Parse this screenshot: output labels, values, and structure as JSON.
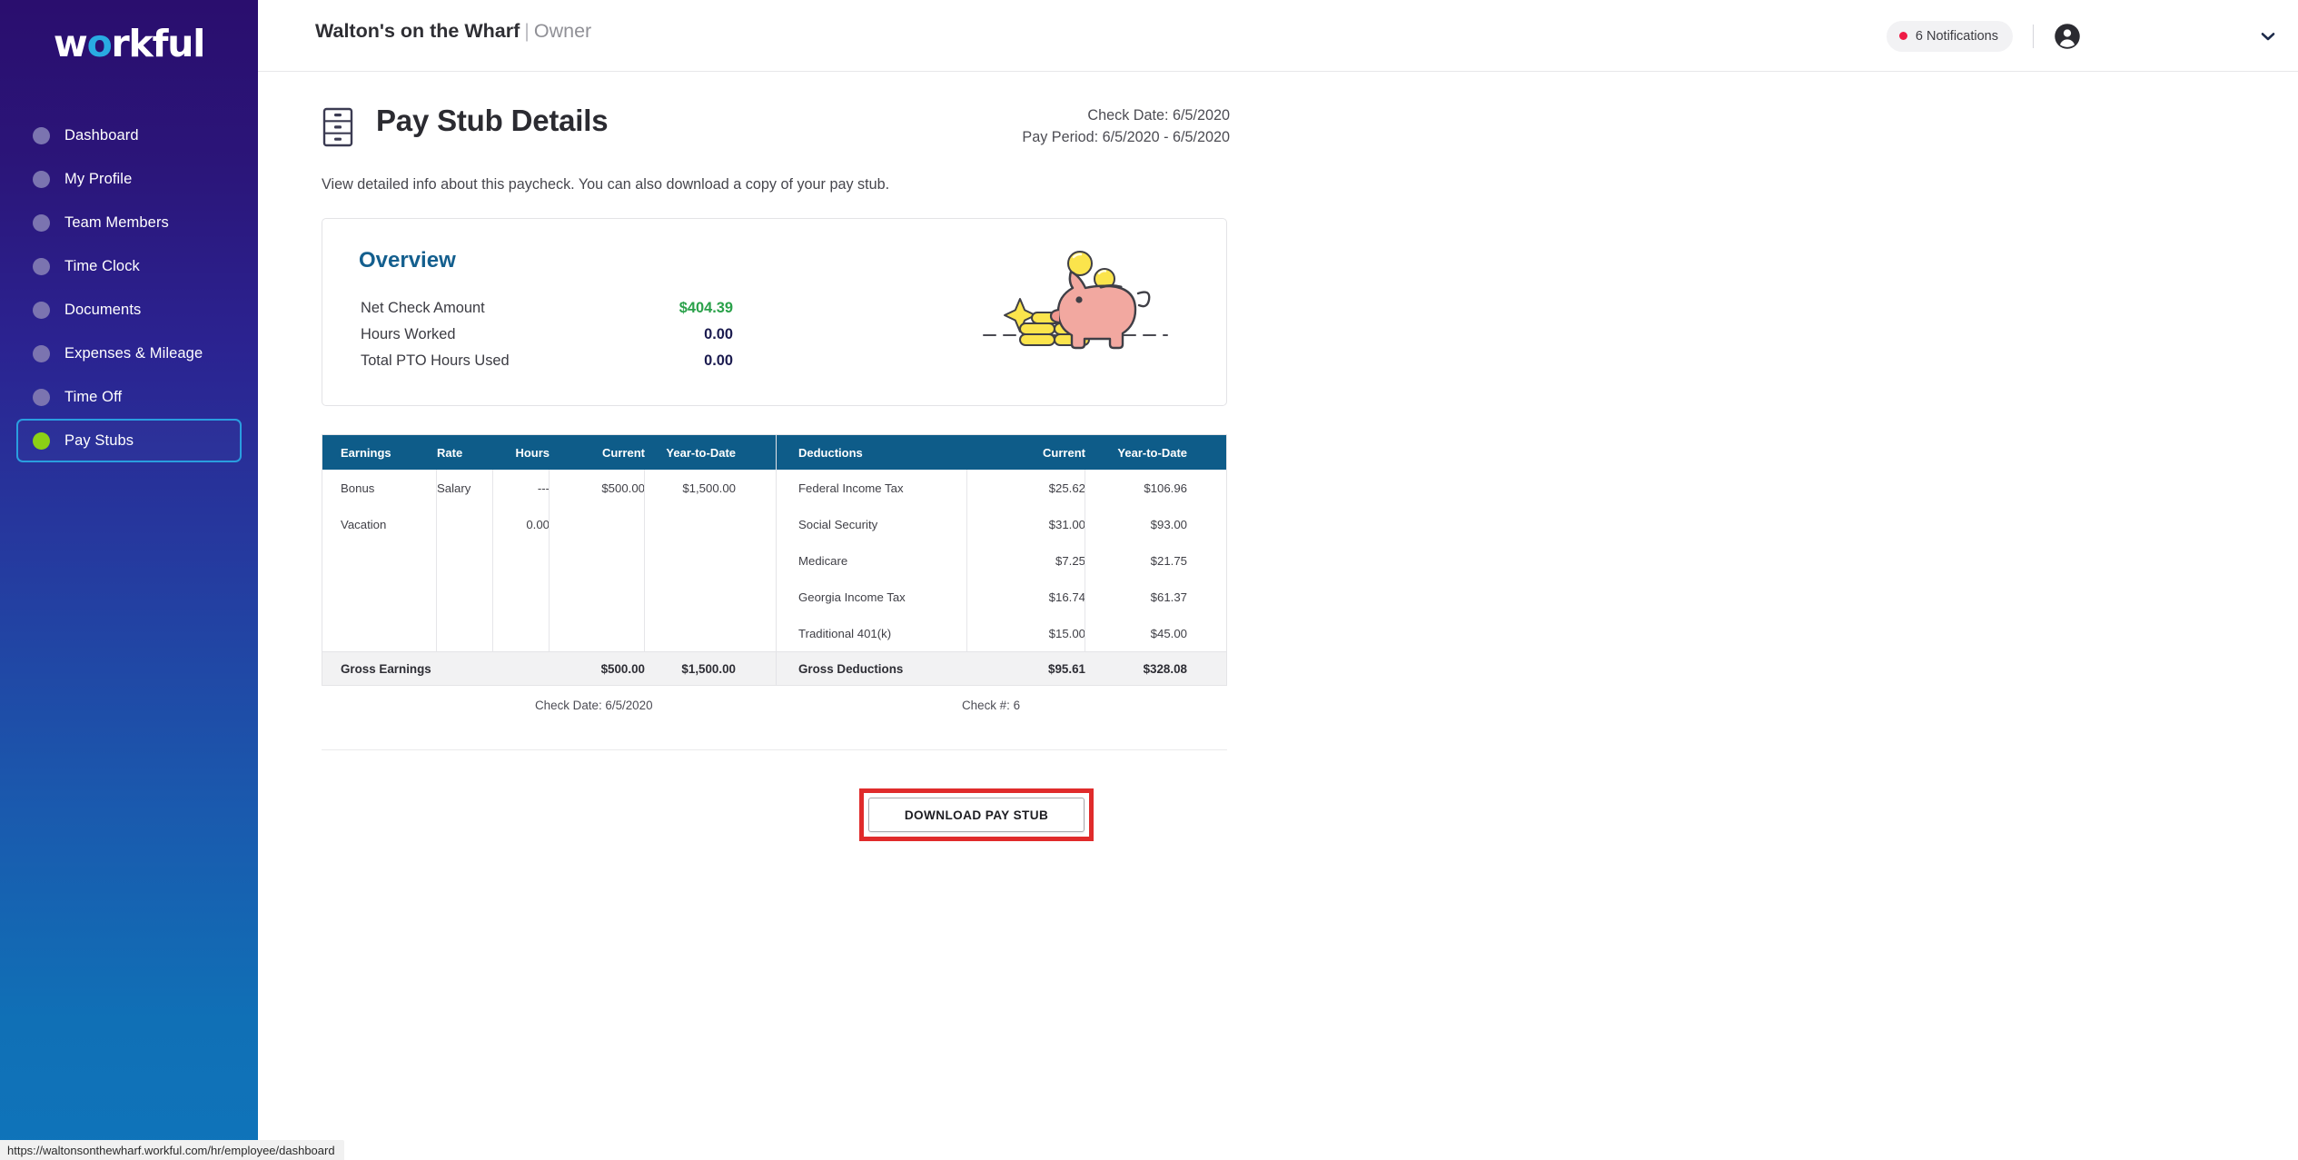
{
  "sidebar": {
    "logo": {
      "text_before": "w",
      "accent": "o",
      "text_after": "rkful",
      "full": "workful"
    },
    "items": [
      {
        "label": "Dashboard",
        "active": false
      },
      {
        "label": "My Profile",
        "active": false
      },
      {
        "label": "Team Members",
        "active": false
      },
      {
        "label": "Time Clock",
        "active": false
      },
      {
        "label": "Documents",
        "active": false
      },
      {
        "label": "Expenses & Mileage",
        "active": false
      },
      {
        "label": "Time Off",
        "active": false
      },
      {
        "label": "Pay Stubs",
        "active": true
      }
    ],
    "active_item": "Pay Stubs",
    "colors": {
      "gradient_top": "#2a0e6e",
      "gradient_bottom": "#0f74ba",
      "active_border": "#2a9ee0",
      "active_dot": "#8cd116",
      "inactive_dot": "#7b74b0",
      "logo_accent": "#29abe2"
    }
  },
  "header": {
    "company": "Walton's on the Wharf",
    "separator": "|",
    "role": "Owner",
    "notifications_label": "6 Notifications",
    "notifications_count": 6,
    "notification_dot_color": "#ef1b46",
    "avatar_icon": "account-circle-icon",
    "caret_icon": "chevron-down-icon"
  },
  "page": {
    "icon": "filing-cabinet-icon",
    "title": "Pay Stub Details",
    "subtitle": "View detailed info about this paycheck. You can also download a copy of your pay stub.",
    "check_date_label": "Check Date: 6/5/2020",
    "pay_period_label": "Pay Period: 6/5/2020 - 6/5/2020"
  },
  "overview": {
    "title": "Overview",
    "title_color": "#145f8e",
    "rows": [
      {
        "label": "Net Check Amount",
        "value": "$404.39",
        "money": true
      },
      {
        "label": "Hours Worked",
        "value": "0.00",
        "money": false
      },
      {
        "label": "Total PTO Hours Used",
        "value": "0.00",
        "money": false
      }
    ],
    "illustration": "piggy-bank-illustration",
    "net_color": "#2aa14a"
  },
  "earnings": {
    "headers": [
      "Earnings",
      "Rate",
      "Hours",
      "Current",
      "Year-to-Date"
    ],
    "rows": [
      {
        "name": "Bonus",
        "rate": "Salary",
        "hours": "---",
        "current": "$500.00",
        "ytd": "$1,500.00"
      },
      {
        "name": "Vacation",
        "rate": "",
        "hours": "0.00",
        "current": "",
        "ytd": ""
      }
    ],
    "total": {
      "label": "Gross Earnings",
      "rate": "",
      "hours": "",
      "current": "$500.00",
      "ytd": "$1,500.00"
    }
  },
  "deductions": {
    "headers": [
      "Deductions",
      "Current",
      "Year-to-Date"
    ],
    "rows": [
      {
        "name": "Federal Income Tax",
        "current": "$25.62",
        "ytd": "$106.96"
      },
      {
        "name": "Social Security",
        "current": "$31.00",
        "ytd": "$93.00"
      },
      {
        "name": "Medicare",
        "current": "$7.25",
        "ytd": "$21.75"
      },
      {
        "name": "Georgia Income Tax",
        "current": "$16.74",
        "ytd": "$61.37"
      },
      {
        "name": "Traditional 401(k)",
        "current": "$15.00",
        "ytd": "$45.00"
      }
    ],
    "total": {
      "label": "Gross Deductions",
      "current": "$95.61",
      "ytd": "$328.08"
    }
  },
  "check_footer": {
    "date": "Check Date: 6/5/2020",
    "number": "Check #: 6"
  },
  "actions": {
    "download_label": "DOWNLOAD PAY STUB",
    "highlight_color": "#e02b2b"
  },
  "statusbar": {
    "url": "https://waltonsonthewharf.workful.com/hr/employee/dashboard"
  },
  "theme": {
    "table_header_bg": "#0e5c89",
    "total_row_bg": "#f2f2f3"
  }
}
